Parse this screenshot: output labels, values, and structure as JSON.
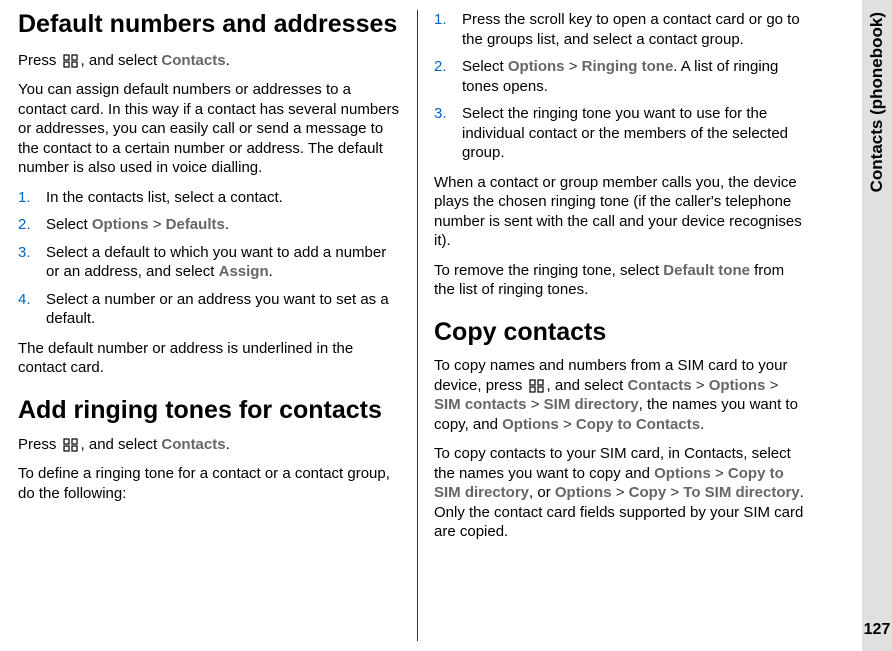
{
  "sideTab": {
    "label": "Contacts (phonebook)",
    "pageNum": "127"
  },
  "left": {
    "heading1": "Default numbers and addresses",
    "p1a": "Press ",
    "p1b": ", and select ",
    "p1c": "Contacts",
    "p1d": ".",
    "p2": "You can assign default numbers or addresses to a contact card. In this way if a contact has several numbers or addresses, you can easily call or send a message to the contact to a certain number or address. The default number is also used in voice dialling.",
    "steps1": {
      "s1": "In the contacts list, select a contact.",
      "s2a": "Select ",
      "s2b": "Options",
      "s2c": " > ",
      "s2d": "Defaults",
      "s2e": ".",
      "s3a": "Select a default to which you want to add a number or an address, and select ",
      "s3b": "Assign",
      "s3c": ".",
      "s4": "Select a number or an address you want to set as a default."
    },
    "p3": "The default number or address is underlined in the contact card.",
    "heading2": "Add ringing tones for contacts",
    "p4a": "Press ",
    "p4b": ", and select ",
    "p4c": "Contacts",
    "p4d": ".",
    "p5": "To define a ringing tone for a contact or a contact group, do the following:"
  },
  "right": {
    "steps2": {
      "s1": "Press the scroll key to open a contact card or go to the groups list, and select a contact group.",
      "s2a": "Select ",
      "s2b": "Options",
      "s2c": " > ",
      "s2d": "Ringing tone",
      "s2e": ". A list of ringing tones opens.",
      "s3": "Select the ringing tone you want to use for the individual contact or the members of the selected group."
    },
    "p6": "When a contact or group member calls you, the device plays the chosen ringing tone (if the caller's telephone number is sent with the call and your device recognises it).",
    "p7a": "To remove the ringing tone, select ",
    "p7b": "Default tone",
    "p7c": " from the list of ringing tones.",
    "heading3": "Copy contacts",
    "p8a": "To copy names and numbers from a SIM card to your device, press ",
    "p8b": ", and select ",
    "p8c": "Contacts",
    "p8d": " > ",
    "p8e": "Options",
    "p8f": " > ",
    "p8g": "SIM contacts",
    "p8h": " > ",
    "p8i": "SIM directory",
    "p8j": ", the names you want to copy, and ",
    "p8k": "Options",
    "p8l": " > ",
    "p8m": "Copy to Contacts",
    "p8n": ".",
    "p9a": "To copy contacts to your SIM card, in Contacts, select the names you want to copy and ",
    "p9b": "Options",
    "p9c": " > ",
    "p9d": "Copy to SIM directory",
    "p9e": ", or ",
    "p9f": "Options",
    "p9g": " > ",
    "p9h": "Copy",
    "p9i": " > ",
    "p9j": "To SIM directory",
    "p9k": ". Only the contact card fields supported by your SIM card are copied."
  }
}
